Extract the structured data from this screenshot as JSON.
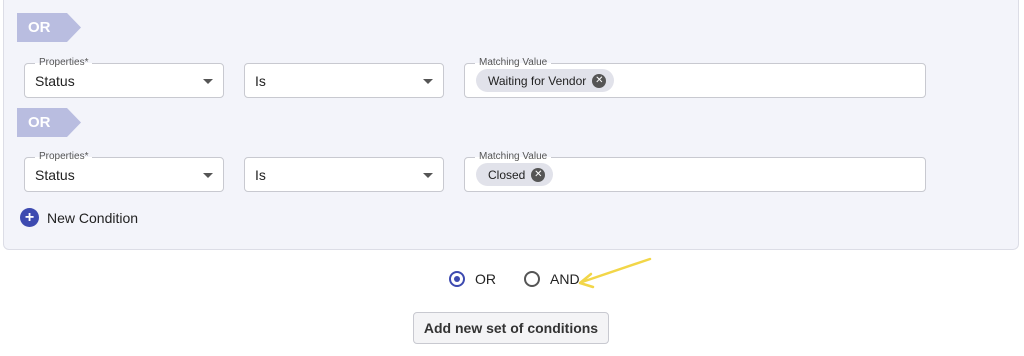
{
  "groups": [
    {
      "operator": "OR",
      "property_label": "Properties*",
      "property_value": "Status",
      "condition_value": "Is",
      "matching_label": "Matching Value",
      "chip": "Waiting for Vendor"
    },
    {
      "operator": "OR",
      "property_label": "Properties*",
      "property_value": "Status",
      "condition_value": "Is",
      "matching_label": "Matching Value",
      "chip": "Closed"
    }
  ],
  "new_condition_label": "New Condition",
  "logic": {
    "options": [
      "OR",
      "AND"
    ],
    "selected": "OR"
  },
  "add_set_label": "Add new set of conditions",
  "colors": {
    "accent": "#3d4ab0",
    "or_tag": "#b9bde0",
    "panel_bg": "#f3f4fa",
    "annotation_arrow": "#f2d648"
  },
  "icons": {
    "chip_remove": "close-circle-icon",
    "dropdown": "caret-down-icon",
    "add": "plus-circle-icon"
  }
}
